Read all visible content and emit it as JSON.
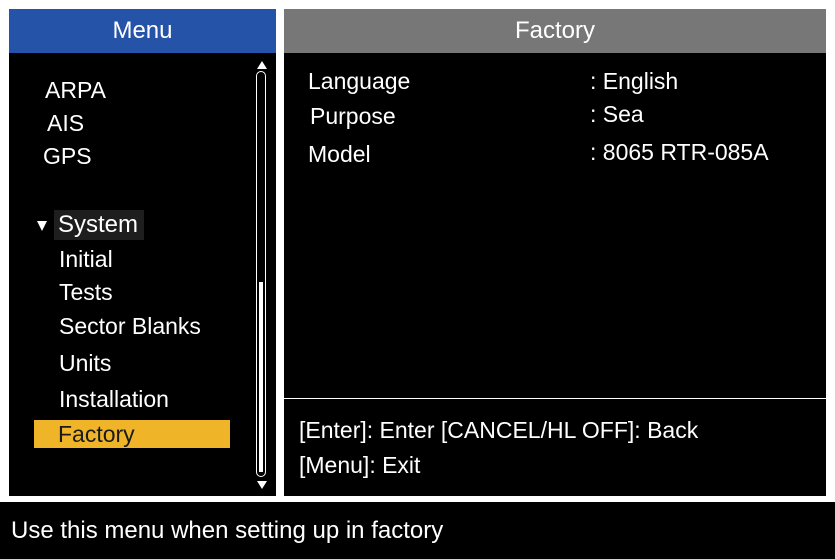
{
  "menu": {
    "title": "Menu",
    "items": [
      {
        "label": "ARPA"
      },
      {
        "label": "AIS"
      },
      {
        "label": "GPS"
      }
    ],
    "group": {
      "label": "System",
      "expanded": true,
      "children": [
        {
          "label": "Initial"
        },
        {
          "label": "Tests"
        },
        {
          "label": "Sector Blanks"
        },
        {
          "label": "Units"
        },
        {
          "label": "Installation"
        },
        {
          "label": "Factory",
          "selected": true
        }
      ]
    }
  },
  "panel": {
    "title": "Factory",
    "rows": [
      {
        "label": "Language",
        "value": ": English"
      },
      {
        "label": "Purpose",
        "value": ": Sea"
      },
      {
        "label": "Model",
        "value": ": 8065 RTR-085A"
      }
    ],
    "help": {
      "line1": "[Enter]: Enter [CANCEL/HL OFF]: Back",
      "line2": "[Menu]: Exit"
    }
  },
  "status": {
    "text": "Use this menu when setting up in factory"
  },
  "colors": {
    "menu_header": "#2553a8",
    "panel_header": "#777777",
    "selection": "#f0b429",
    "background": "#000000"
  },
  "icons": {
    "expand": "triangle-down-icon",
    "scroll_up": "scroll-up-arrow-icon",
    "scroll_down": "scroll-down-arrow-icon"
  }
}
